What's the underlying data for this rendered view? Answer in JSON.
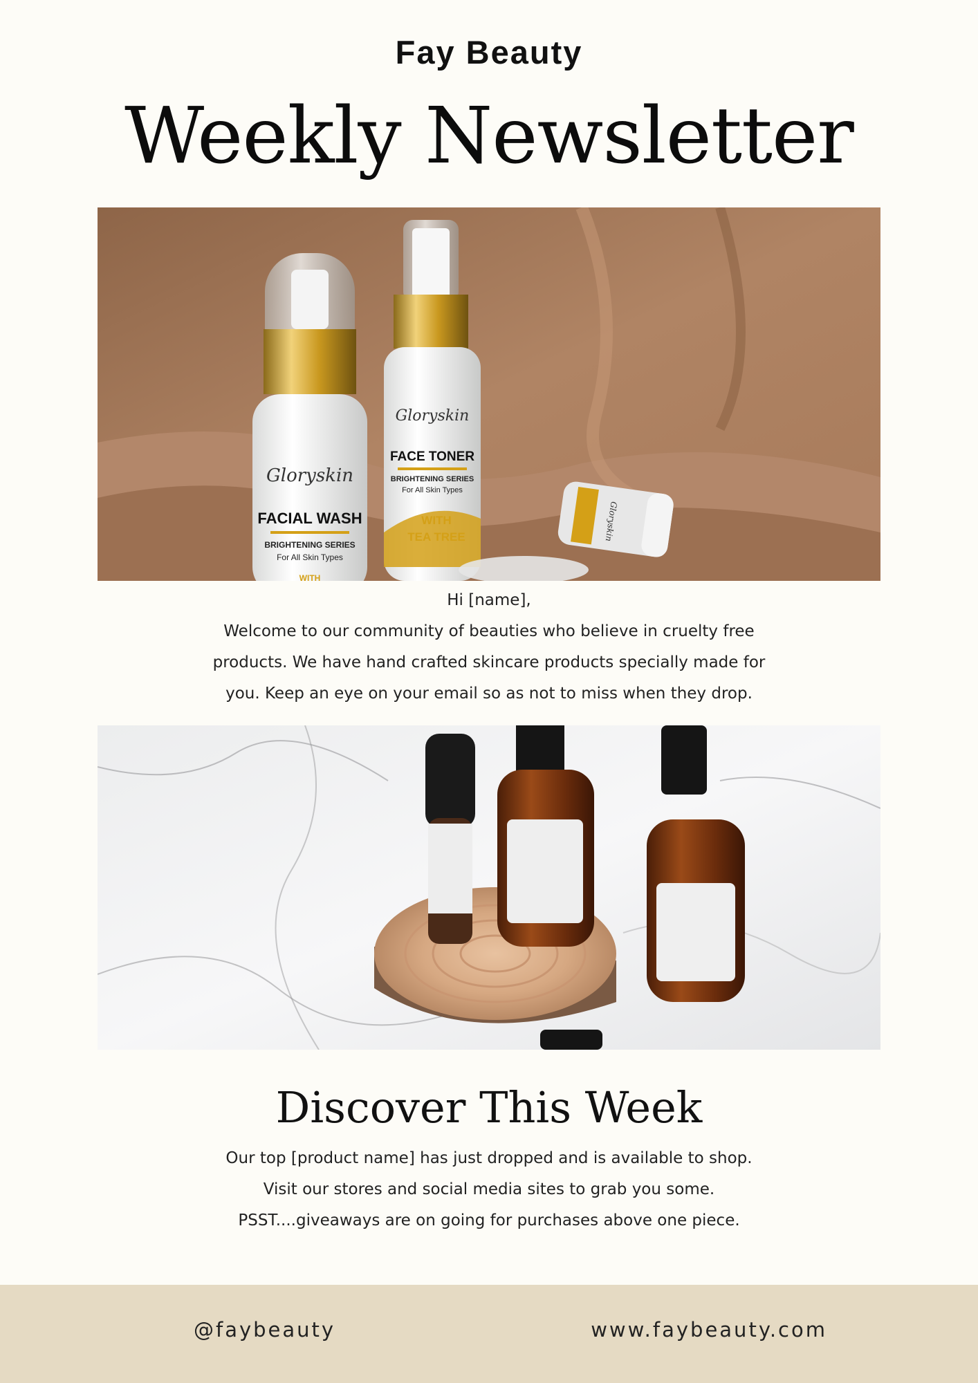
{
  "header": {
    "brand": "Fay Beauty",
    "title": "Weekly Newsletter"
  },
  "hero_image": {
    "description_icon": "product-photo",
    "bottle_1": {
      "brand": "Gloryskin",
      "name": "FACIAL WASH",
      "series": "BRIGHTENING SERIES",
      "sub": "For All Skin Types",
      "extra": "WITH"
    },
    "bottle_2": {
      "brand": "Gloryskin",
      "name": "FACE TONER",
      "series": "BRIGHTENING SERIES",
      "sub": "For All Skin Types",
      "extra_1": "WITH",
      "extra_2": "TEA TREE"
    },
    "jar": {
      "brand": "Gloryskin"
    }
  },
  "intro": {
    "greeting": "Hi [name],",
    "line_1": "Welcome to our community of beauties who believe in cruelty free",
    "line_2": "products. We have hand crafted skincare products specially made for",
    "line_3": "you. Keep an eye on your email so as not to miss when they drop."
  },
  "discover": {
    "title": "Discover This Week",
    "line_1": "Our top [product name] has just dropped and is available to shop.",
    "line_2": "Visit our stores and social media sites to grab you some.",
    "line_3": "PSST....giveaways are on going for purchases above one piece."
  },
  "footer": {
    "social": "@faybeauty",
    "website": "www.faybeauty.com"
  },
  "colors": {
    "background": "#fdfcf7",
    "footer": "#e5dac3",
    "fabric": "#a87a58",
    "gold": "#d4a017"
  }
}
